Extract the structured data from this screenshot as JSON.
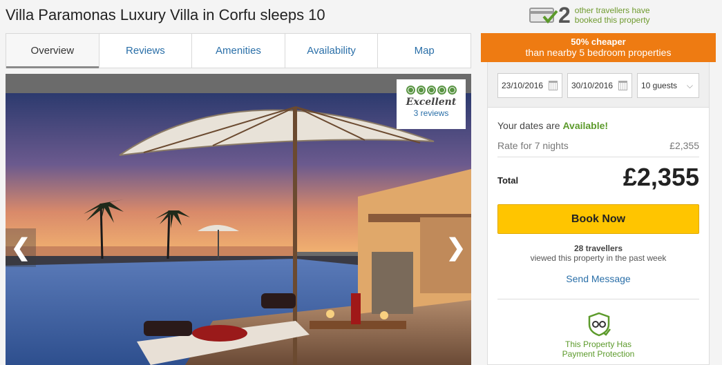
{
  "page": {
    "title": "Villa Paramonas Luxury Villa in Corfu sleeps 10"
  },
  "booked_notice": {
    "count": "2",
    "line1": "other travellers have",
    "line2": "booked this property"
  },
  "tabs": [
    {
      "label": "Overview",
      "active": true
    },
    {
      "label": "Reviews",
      "active": false
    },
    {
      "label": "Amenities",
      "active": false
    },
    {
      "label": "Availability",
      "active": false
    },
    {
      "label": "Map",
      "active": false
    }
  ],
  "gallery": {
    "prev_icon": "chevron-left-icon",
    "next_icon": "chevron-right-icon",
    "prev_glyph": "❮",
    "next_glyph": "❯"
  },
  "tripadvisor": {
    "rating_text": "Excellent",
    "reviews_link": "3 reviews",
    "bubbles": 5
  },
  "deal_banner": {
    "line1": "50% cheaper",
    "line2": "than nearby 5 bedroom properties",
    "color": "#ee7b12"
  },
  "booking": {
    "checkin": "23/10/2016",
    "checkout": "30/10/2016",
    "guests": "10 guests",
    "availability_prefix": "Your dates are",
    "availability_status": "Available!",
    "rate_label": "Rate for 7 nights",
    "rate_value": "£2,355",
    "total_label": "Total",
    "total_value": "£2,355",
    "book_button": "Book Now",
    "viewed_count": "28 travellers",
    "viewed_text": "viewed this property in the past week",
    "send_message": "Send Message",
    "protection_line1": "This Property Has",
    "protection_line2": "Payment Protection"
  },
  "colors": {
    "link": "#2a6fa8",
    "accent_green": "#5c9a2b",
    "book_button": "#ffc500"
  }
}
